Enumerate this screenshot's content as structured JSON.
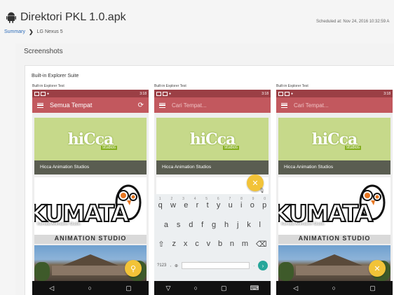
{
  "header": {
    "title": "Direktori PKL 1.0.apk",
    "breadcrumb": {
      "summary": "Summary",
      "separator": "❯",
      "device": "LG Nexus 5"
    },
    "scheduled": "Scheduled at: Nov 24, 2016 10:32:59 A"
  },
  "section": {
    "title": "Screenshots"
  },
  "suite": {
    "title": "Built-in Explorer Suite"
  },
  "screenshots": [
    {
      "label": "Built-in Explorer Test",
      "status_time": "3:18",
      "appbar_title": "Semua Tempat",
      "refresh_icon": "⟳",
      "card1_caption": "Hicca Animation Studios",
      "hicca_logo": "hiCca",
      "hicca_sub": "studios",
      "kumata_caption": "Kumata Animation Studio",
      "kumata_big": "KUMATA",
      "kumata_sub": "ANIMATION STUDIO",
      "fab_icon": "⚲",
      "nav": [
        "◁",
        "○",
        "▢"
      ]
    },
    {
      "label": "Built-in Explorer Test",
      "status_time": "3:18",
      "search_placeholder": "Cari Tempat...",
      "card1_caption": "Hicca Animation Studios",
      "hicca_logo": "hiCca",
      "hicca_sub": "studios",
      "fab_icon": "✕",
      "keyboard": {
        "numbers": [
          "1",
          "2",
          "3",
          "4",
          "5",
          "6",
          "7",
          "8",
          "9",
          "0"
        ],
        "row1": [
          "q",
          "w",
          "e",
          "r",
          "t",
          "y",
          "u",
          "i",
          "o",
          "p"
        ],
        "row2": [
          "a",
          "s",
          "d",
          "f",
          "g",
          "h",
          "j",
          "k",
          "l"
        ],
        "row3": [
          "⇧",
          "z",
          "x",
          "c",
          "v",
          "b",
          "n",
          "m",
          "⌫"
        ],
        "sym": "?123",
        "comma": ",",
        "globe": "⊕",
        "period": ".",
        "go": "›",
        "mic": "🎙"
      },
      "nav": [
        "▽",
        "○",
        "▢",
        "⌨"
      ]
    },
    {
      "label": "Built-in Explorer Test",
      "status_time": "3:18",
      "search_placeholder": "Cari Tempat...",
      "card1_caption": "Hicca Animation Studios",
      "hicca_logo": "hiCca",
      "hicca_sub": "studios",
      "kumata_caption": "Kumata Animation Studio",
      "kumata_big": "KUMATA",
      "kumata_sub": "ANIMATION STUDIO",
      "fab_icon": "✕",
      "nav": [
        "◁",
        "○",
        "▢"
      ]
    }
  ],
  "colors": {
    "statusbar": "#9b3f45",
    "appbar": "#c2585e",
    "fab": "#f2c338",
    "hicca_bg": "#c6d98a",
    "link": "#2a6ab8"
  }
}
